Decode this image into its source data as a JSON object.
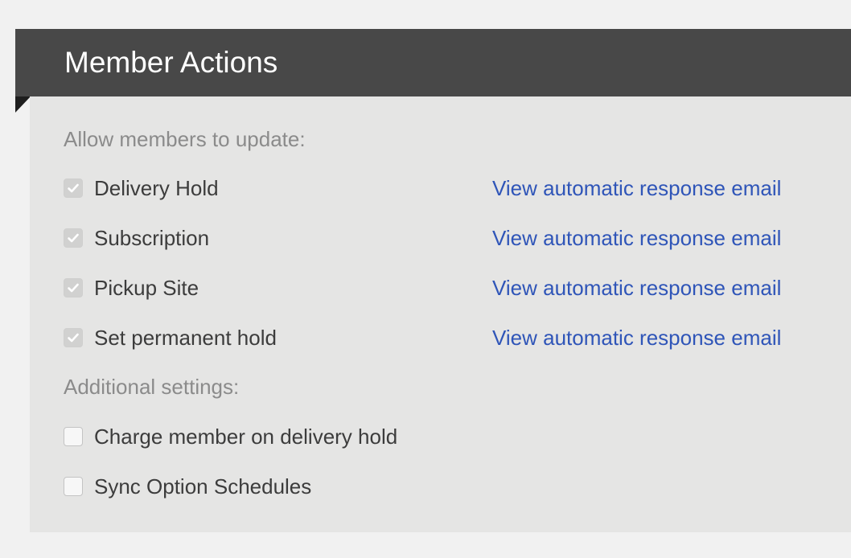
{
  "panel": {
    "title": "Member Actions"
  },
  "update_section": {
    "label": "Allow members to update:",
    "items": [
      {
        "label": "Delivery Hold",
        "checked": true,
        "disabled": true,
        "link": "View automatic response email"
      },
      {
        "label": "Subscription",
        "checked": true,
        "disabled": true,
        "link": "View automatic response email"
      },
      {
        "label": "Pickup Site",
        "checked": true,
        "disabled": true,
        "link": "View automatic response email"
      },
      {
        "label": "Set permanent hold",
        "checked": true,
        "disabled": true,
        "link": "View automatic response email"
      }
    ]
  },
  "additional_section": {
    "label": "Additional settings:",
    "items": [
      {
        "label": "Charge member on delivery hold",
        "checked": false
      },
      {
        "label": "Sync Option Schedules",
        "checked": false
      }
    ]
  },
  "colors": {
    "header_bg": "#484848",
    "body_bg": "#e5e5e4",
    "link": "#2f55b8",
    "muted_text": "#8b8b8b"
  },
  "icons": {
    "checkmark": "check-icon"
  }
}
